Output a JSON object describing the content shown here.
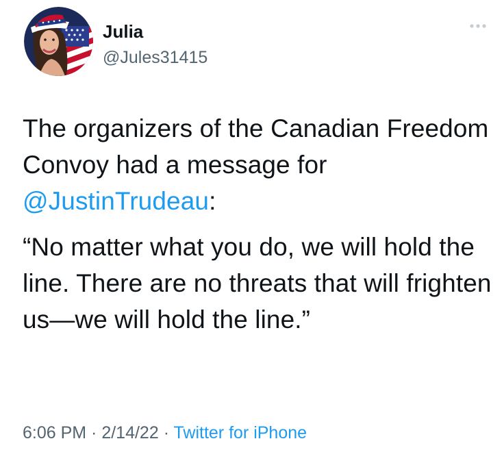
{
  "user": {
    "display_name": "Julia",
    "handle": "@Jules31415"
  },
  "icons": {
    "more": "more-horizontal-icon",
    "avatar": "avatar-photo-flag-hat"
  },
  "tweet": {
    "line1_before": "The organizers of the Canadian Freedom Convoy had a message for ",
    "mention": "@JustinTrudeau",
    "line1_after": ":",
    "quote": "“No matter what you do, we will hold the line. There are no threats that will frighten us—we will hold the line.”"
  },
  "meta": {
    "time": "6:06 PM",
    "separator1": " · ",
    "date": "2/14/22",
    "separator2": " · ",
    "source": "Twitter for iPhone"
  },
  "colors": {
    "link": "#1d9bf0",
    "secondary_text": "#536471",
    "text": "#0f1419"
  }
}
